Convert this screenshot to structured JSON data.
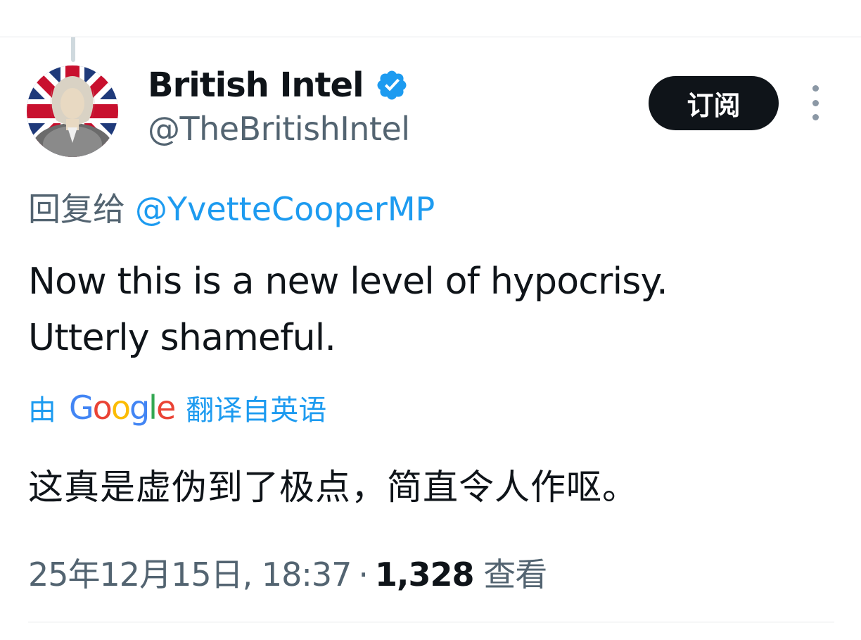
{
  "author": {
    "display_name": "British Intel",
    "handle": "@TheBritishIntel",
    "verified": true
  },
  "subscribe_label": "订阅",
  "reply": {
    "prefix": "回复给",
    "mention": "@YvetteCooperMP"
  },
  "tweet": {
    "lines": [
      "Now this is a new level of hypocrisy.",
      "Utterly shameful."
    ]
  },
  "translation": {
    "by": "由",
    "provider": "Google",
    "from": "翻译自英语",
    "text": "这真是虚伪到了极点，简直令人作呕。"
  },
  "meta": {
    "timestamp": "25年12月15日, 18:37",
    "separator": "·",
    "views_count": "1,328",
    "views_label": "查看"
  },
  "colors": {
    "accent": "#1d9bf0",
    "text_primary": "#0f1419",
    "text_secondary": "#536471",
    "button_bg": "#0f1419"
  },
  "icons": {
    "verified": "verified-badge-icon",
    "more": "more-options-icon",
    "google": "google-logo"
  }
}
